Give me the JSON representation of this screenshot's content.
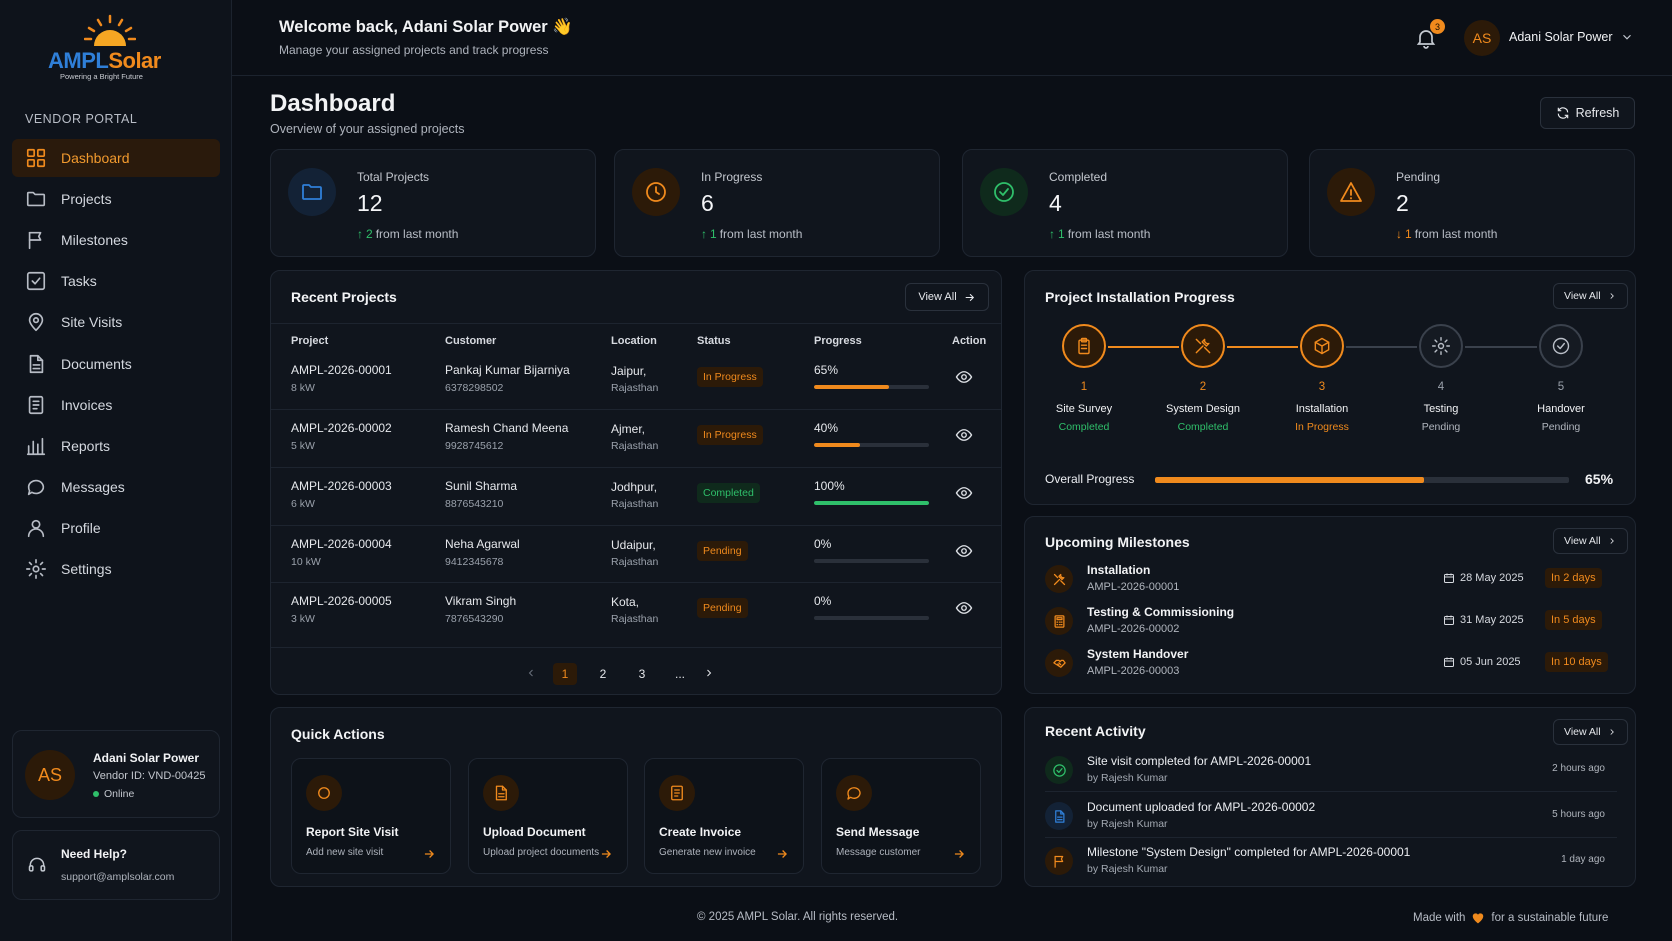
{
  "brand": {
    "name_a": "AMPL",
    "name_b": "Solar",
    "tagline": "Powering a Bright Future"
  },
  "sidebar": {
    "section": "VENDOR PORTAL",
    "items": [
      {
        "label": "Dashboard",
        "icon": "grid-icon",
        "active": true
      },
      {
        "label": "Projects",
        "icon": "folder-icon"
      },
      {
        "label": "Milestones",
        "icon": "flag-icon"
      },
      {
        "label": "Tasks",
        "icon": "checkbox-icon"
      },
      {
        "label": "Site Visits",
        "icon": "map-pin-icon"
      },
      {
        "label": "Documents",
        "icon": "document-icon"
      },
      {
        "label": "Invoices",
        "icon": "invoice-icon"
      },
      {
        "label": "Reports",
        "icon": "bar-chart-icon"
      },
      {
        "label": "Messages",
        "icon": "chat-icon"
      },
      {
        "label": "Profile",
        "icon": "user-icon"
      },
      {
        "label": "Settings",
        "icon": "gear-icon"
      }
    ],
    "user": {
      "initials": "AS",
      "name": "Adani Solar Power",
      "vendor_id": "Vendor ID: VND-00425",
      "status": "Online"
    },
    "help": {
      "title": "Need Help?",
      "email": "support@amplsolar.com"
    }
  },
  "header": {
    "welcome": "Welcome back, Adani Solar Power",
    "wave": "👋",
    "subtitle": "Manage your assigned projects and track progress",
    "notifications": "3",
    "user_initials": "AS",
    "user_name": "Adani Solar Power"
  },
  "page": {
    "title": "Dashboard",
    "subtitle": "Overview of your assigned projects",
    "refresh": "Refresh"
  },
  "stats": [
    {
      "label": "Total Projects",
      "value": "12",
      "delta": "2",
      "delta_text": "from last month",
      "direction": "up",
      "icon": "folder-icon",
      "color": "#2f7fd8"
    },
    {
      "label": "In Progress",
      "value": "6",
      "delta": "1",
      "delta_text": "from last month",
      "direction": "up",
      "icon": "clock-icon",
      "color": "#f08a1d"
    },
    {
      "label": "Completed",
      "value": "4",
      "delta": "1",
      "delta_text": "from last month",
      "direction": "up",
      "icon": "check-circle-icon",
      "color": "#2fbf6a"
    },
    {
      "label": "Pending",
      "value": "2",
      "delta": "1",
      "delta_text": "from last month",
      "direction": "down",
      "icon": "warning-icon",
      "color": "#f08a1d"
    }
  ],
  "recent_projects": {
    "title": "Recent Projects",
    "view_all": "View All",
    "columns": [
      "Project",
      "Customer",
      "Location",
      "Status",
      "Progress",
      "Action"
    ],
    "rows": [
      {
        "id": "AMPL-2026-00001",
        "size": "8 kW",
        "customer": "Pankaj Kumar Bijarniya",
        "phone": "6378298502",
        "city": "Jaipur,",
        "state": "Rajasthan",
        "status": "In Progress",
        "progress": 65,
        "progress_label": "65%"
      },
      {
        "id": "AMPL-2026-00002",
        "size": "5 kW",
        "customer": "Ramesh Chand Meena",
        "phone": "9928745612",
        "city": "Ajmer,",
        "state": "Rajasthan",
        "status": "In Progress",
        "progress": 40,
        "progress_label": "40%"
      },
      {
        "id": "AMPL-2026-00003",
        "size": "6 kW",
        "customer": "Sunil Sharma",
        "phone": "8876543210",
        "city": "Jodhpur,",
        "state": "Rajasthan",
        "status": "Completed",
        "progress": 100,
        "progress_label": "100%"
      },
      {
        "id": "AMPL-2026-00004",
        "size": "10 kW",
        "customer": "Neha Agarwal",
        "phone": "9412345678",
        "city": "Udaipur,",
        "state": "Rajasthan",
        "status": "Pending",
        "progress": 0,
        "progress_label": "0%"
      },
      {
        "id": "AMPL-2026-00005",
        "size": "3 kW",
        "customer": "Vikram Singh",
        "phone": "7876543290",
        "city": "Kota,",
        "state": "Rajasthan",
        "status": "Pending",
        "progress": 0,
        "progress_label": "0%"
      }
    ],
    "pages": [
      "1",
      "2",
      "3",
      "..."
    ]
  },
  "quick_actions": {
    "title": "Quick Actions",
    "items": [
      {
        "title": "Report Site Visit",
        "sub": "Add new site visit",
        "icon": "circle-icon"
      },
      {
        "title": "Upload Document",
        "sub": "Upload project documents",
        "icon": "document-icon"
      },
      {
        "title": "Create Invoice",
        "sub": "Generate new invoice",
        "icon": "invoice-icon"
      },
      {
        "title": "Send Message",
        "sub": "Message customer",
        "icon": "chat-icon"
      }
    ]
  },
  "installation": {
    "title": "Project Installation Progress",
    "view_all": "View All",
    "steps": [
      {
        "n": "1",
        "label": "Site Survey",
        "status": "Completed",
        "state": "done",
        "icon": "clipboard-icon"
      },
      {
        "n": "2",
        "label": "System Design",
        "status": "Completed",
        "state": "done",
        "icon": "tools-icon"
      },
      {
        "n": "3",
        "label": "Installation",
        "status": "In Progress",
        "state": "active",
        "icon": "box-icon"
      },
      {
        "n": "4",
        "label": "Testing",
        "status": "Pending",
        "state": "pending",
        "icon": "gear-icon"
      },
      {
        "n": "5",
        "label": "Handover",
        "status": "Pending",
        "state": "pending",
        "icon": "check-circle-icon"
      }
    ],
    "overall_label": "Overall Progress",
    "overall_value": 65,
    "overall_text": "65%"
  },
  "milestones": {
    "title": "Upcoming Milestones",
    "view_all": "View All",
    "items": [
      {
        "title": "Installation",
        "code": "AMPL-2026-00001",
        "date": "28 May 2025",
        "due": "In 2 days",
        "icon": "tools-icon"
      },
      {
        "title": "Testing & Commissioning",
        "code": "AMPL-2026-00002",
        "date": "31 May 2025",
        "due": "In 5 days",
        "icon": "calculator-icon"
      },
      {
        "title": "System Handover",
        "code": "AMPL-2026-00003",
        "date": "05 Jun 2025",
        "due": "In 10 days",
        "icon": "handshake-icon"
      }
    ]
  },
  "activity": {
    "title": "Recent Activity",
    "view_all": "View All",
    "items": [
      {
        "text": "Site visit completed for AMPL-2026-00001",
        "by": "by Rajesh Kumar",
        "time": "2 hours ago",
        "icon": "check-circle-icon",
        "color": "#2fbf6a"
      },
      {
        "text": "Document uploaded for AMPL-2026-00002",
        "by": "by Rajesh Kumar",
        "time": "5 hours ago",
        "icon": "document-icon",
        "color": "#2f7fd8"
      },
      {
        "text": "Milestone \"System Design\" completed for AMPL-2026-00001",
        "by": "by Rajesh Kumar",
        "time": "1 day ago",
        "icon": "flag-icon",
        "color": "#f08a1d"
      }
    ]
  },
  "footer": {
    "copyright": "© 2025 AMPL Solar. All rights reserved.",
    "made_with": "Made with",
    "tail": "for a sustainable future"
  }
}
